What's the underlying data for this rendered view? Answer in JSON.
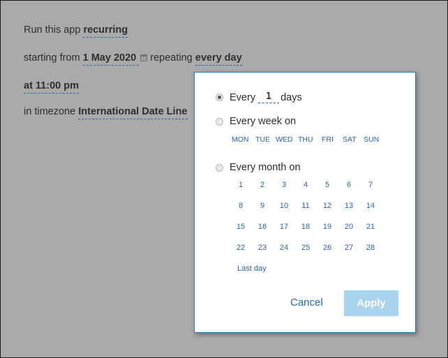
{
  "background": {
    "line1_prefix": "Run this app",
    "line1_link": "recurring",
    "line2_prefix": "starting from",
    "line2_date": " 1 May 2020 ",
    "line2_middle": "repeating",
    "line2_link": "every day",
    "line3_link": "at 11:00 pm",
    "line4_prefix": "in timezone",
    "line4_link": "International Date Line"
  },
  "popup": {
    "option_days": {
      "prefix": "Every",
      "value": "1",
      "suffix": "days",
      "selected": true
    },
    "option_week": {
      "label": "Every week on",
      "selected": false
    },
    "weekdays": [
      "MON",
      "TUE",
      "WED",
      "THU",
      "FRI",
      "SAT",
      "SUN"
    ],
    "option_month": {
      "label": "Every month on",
      "selected": false
    },
    "month_days": [
      "1",
      "2",
      "3",
      "4",
      "5",
      "6",
      "7",
      "8",
      "9",
      "10",
      "11",
      "12",
      "13",
      "14",
      "15",
      "16",
      "17",
      "18",
      "19",
      "20",
      "21",
      "22",
      "23",
      "24",
      "25",
      "26",
      "27",
      "28"
    ],
    "last_day_label": "Last day",
    "cancel_label": "Cancel",
    "apply_label": "Apply"
  },
  "colors": {
    "accent": "#1a7fc9",
    "link": "#2b63a8",
    "apply_disabled": "#a8d3ee",
    "overlay": "#aaaaaa"
  }
}
